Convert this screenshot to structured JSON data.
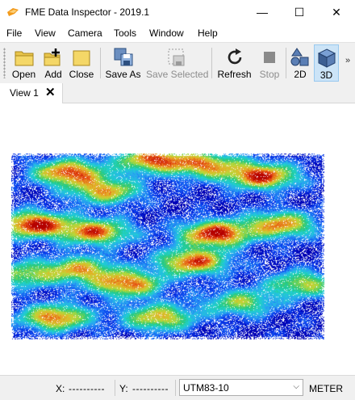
{
  "window": {
    "title": "FME Data Inspector - 2019.1",
    "minimize": "—",
    "maximize": "☐",
    "close": "✕"
  },
  "menu": [
    "File",
    "View",
    "Camera",
    "Tools",
    "Window",
    "Help"
  ],
  "toolbar": {
    "open": "Open",
    "add": "Add",
    "close": "Close",
    "save_as": "Save As",
    "save_selected": "Save Selected",
    "refresh": "Refresh",
    "stop": "Stop",
    "view_2d": "2D",
    "view_3d": "3D",
    "overflow": "»",
    "active_view": "3D"
  },
  "tabs": [
    {
      "label": "View 1",
      "close": "✕"
    }
  ],
  "status": {
    "x_label": "X:",
    "x_value": "----------",
    "y_label": "Y:",
    "y_value": "----------",
    "coord_system": "UTM83-10",
    "combo_arrow": "⌵",
    "units": "METER"
  },
  "colors": {
    "elevation_ramp": [
      "#0000b4",
      "#0a3cf0",
      "#2a9ef5",
      "#20d2d2",
      "#28c878",
      "#b4dc3c",
      "#e6b428",
      "#e64614",
      "#b40000"
    ],
    "accent_selected": "#cce4f7"
  }
}
